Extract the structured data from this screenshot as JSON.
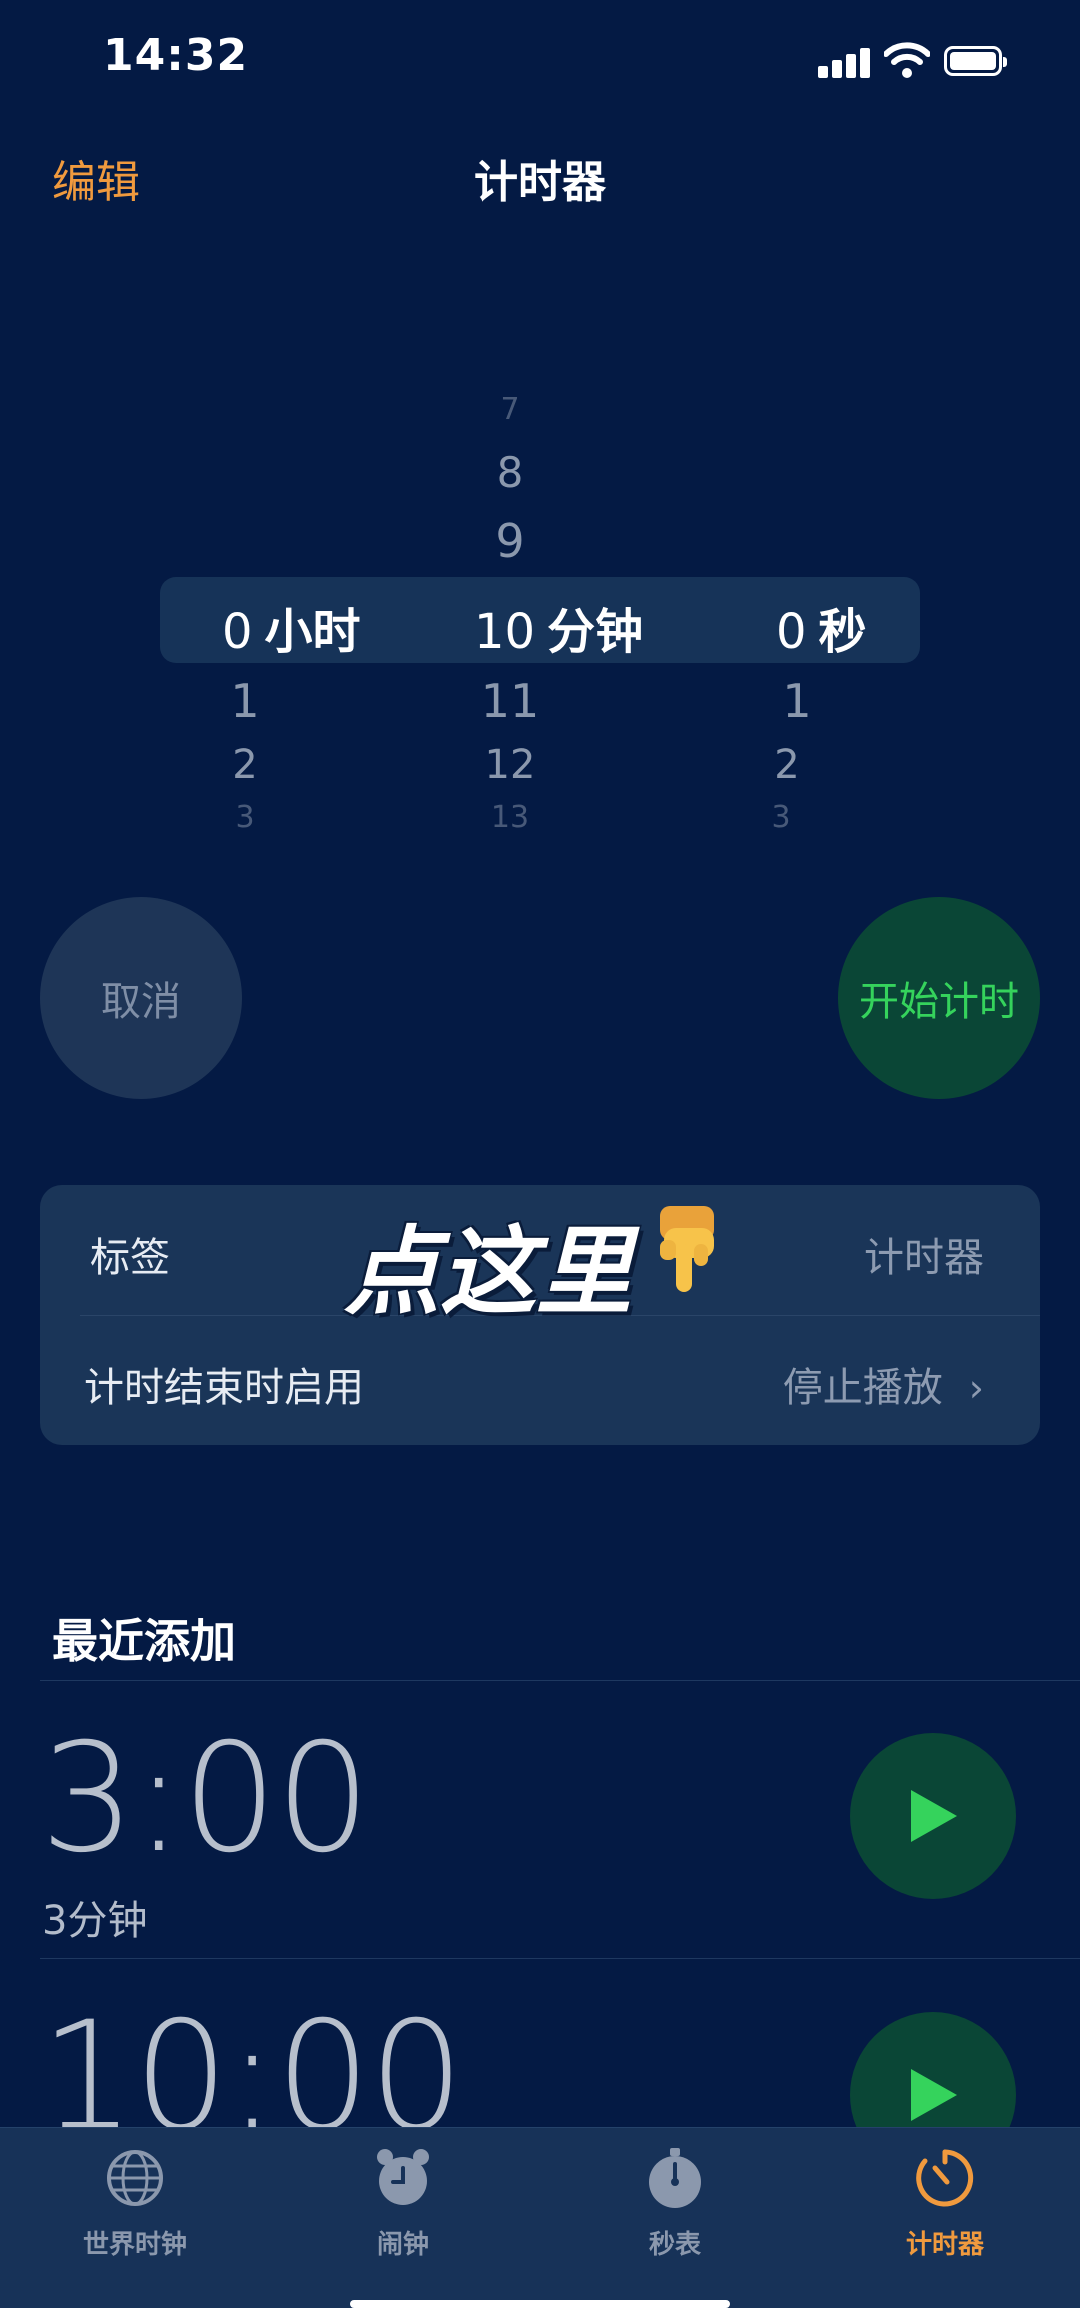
{
  "status": {
    "time": "14:32"
  },
  "nav": {
    "edit_label": "编辑",
    "title": "计时器"
  },
  "picker": {
    "hours": {
      "above": [
        "",
        "",
        ""
      ],
      "selected": "0",
      "unit": "小时",
      "below": [
        "1",
        "2",
        "3"
      ]
    },
    "minutes": {
      "above": [
        "7",
        "8",
        "9"
      ],
      "selected": "10",
      "unit": "分钟",
      "below": [
        "11",
        "12",
        "13"
      ]
    },
    "seconds": {
      "above": [
        "",
        "",
        ""
      ],
      "selected": "0",
      "unit": "秒",
      "below": [
        "1",
        "2",
        "3"
      ]
    }
  },
  "buttons": {
    "cancel": "取消",
    "start": "开始计时"
  },
  "settings": {
    "label_title": "标签",
    "label_value": "计时器",
    "end_title": "计时结束时启用",
    "end_value": "停止播放",
    "chevron": "›"
  },
  "overlay": {
    "text": "点这里"
  },
  "recents": {
    "title": "最近添加",
    "items": [
      {
        "time": "3:00",
        "subtitle": "3分钟"
      },
      {
        "time": "10:00",
        "subtitle": ""
      }
    ]
  },
  "tabs": [
    {
      "label": "世界时钟",
      "icon": "globe-icon"
    },
    {
      "label": "闹钟",
      "icon": "alarm-clock-icon"
    },
    {
      "label": "秒表",
      "icon": "stopwatch-icon"
    },
    {
      "label": "计时器",
      "icon": "timer-icon",
      "active": true
    }
  ],
  "colors": {
    "background": "#041a44",
    "accent": "#f09a3e",
    "start_green": "#35d35c"
  }
}
